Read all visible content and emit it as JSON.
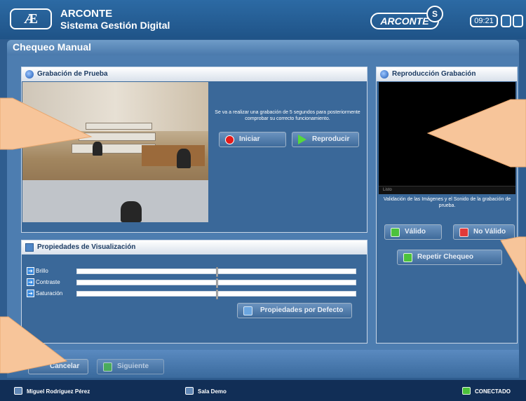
{
  "header": {
    "logo": "Æ",
    "app_name": "ARCONTE",
    "app_subtitle": "Sistema Gestión Digital",
    "brand": "ARCONTE",
    "brand_badge": "S",
    "clock": "09:21"
  },
  "page_title": "Chequeo Manual",
  "recording_panel": {
    "title": "Grabación de Prueba",
    "info": "Se va a realizar una grabación de 5 segundos para posteriormente comprobar su correcto funcionamiento.",
    "start_label": "Iniciar",
    "play_label": "Reproducir"
  },
  "visual_props_panel": {
    "title": "Propiedades de Visualización",
    "sliders": [
      {
        "label": "Brillo",
        "value": 0.5
      },
      {
        "label": "Contraste",
        "value": 0.5
      },
      {
        "label": "Saturación",
        "value": 0.5
      }
    ],
    "default_label": "Propiedades por Defecto"
  },
  "playback_panel": {
    "title": "Reproducción Grabación",
    "status": "Listo",
    "validation_text": "Validación de las Imágenes y el Sonido de la grabación de prueba.",
    "valid_label": "Válido",
    "invalid_label": "No Válido",
    "repeat_label": "Repetir Chequeo"
  },
  "footer": {
    "cancel_label": "Cancelar",
    "next_label": "Siguiente"
  },
  "status_bar": {
    "user": "Miguel Rodríguez Pérez",
    "room": "Sala Demo",
    "connection": "CONECTADO"
  },
  "colors": {
    "accent": "#2c6aa4",
    "status_bar": "#112e56",
    "callout": "#f7c59a",
    "connected": "#4cc23b"
  }
}
